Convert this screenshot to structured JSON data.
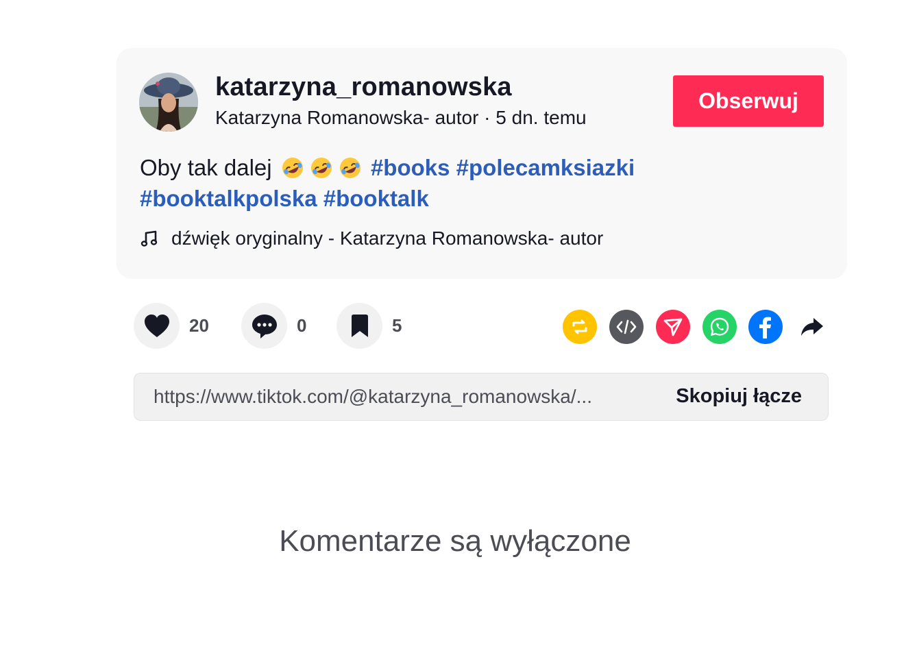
{
  "author": {
    "username": "katarzyna_romanowska",
    "display_name": "Katarzyna Romanowska- autor",
    "separator": " · ",
    "posted": "5 dn. temu",
    "avatar_icon": "user-photo-avatar"
  },
  "follow_button": {
    "label": "Obserwuj",
    "color": "#fe2c55"
  },
  "description": {
    "text": "Oby tak dalej",
    "emoji_icon": "rolling-on-floor-laughing-emoji",
    "hashtags": [
      "#books",
      "#polecamksiazki",
      "#booktalkpolska",
      "#booktalk"
    ],
    "hashtag_color": "#2b5db9"
  },
  "music": {
    "icon": "music-note-icon",
    "label": "dźwięk oryginalny - Katarzyna Romanowska- autor"
  },
  "actions": {
    "likes": {
      "icon": "heart-icon",
      "count": "20"
    },
    "comments": {
      "icon": "comment-icon",
      "count": "0"
    },
    "saves": {
      "icon": "bookmark-icon",
      "count": "5"
    }
  },
  "share": {
    "icons": [
      "repost-icon",
      "embed-icon",
      "send-icon",
      "whatsapp-icon",
      "facebook-icon",
      "share-arrow-icon"
    ],
    "colors": {
      "repost": "#ffc300",
      "embed": "#57585d",
      "send": "#fe2c55",
      "whatsapp": "#25d366",
      "facebook": "#0075fa"
    }
  },
  "link": {
    "url": "https://www.tiktok.com/@katarzyna_romanowska/...",
    "copy_label": "Skopiuj łącze"
  },
  "comments_status": "Komentarze są wyłączone"
}
